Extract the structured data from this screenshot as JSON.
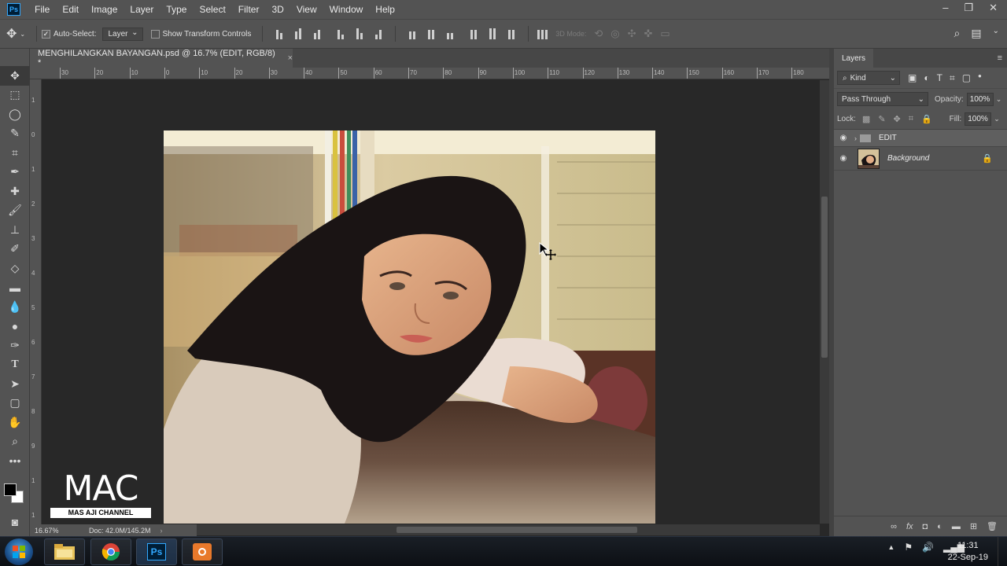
{
  "app": {
    "logo": "Ps"
  },
  "menu": [
    "File",
    "Edit",
    "Image",
    "Layer",
    "Type",
    "Select",
    "Filter",
    "3D",
    "View",
    "Window",
    "Help"
  ],
  "window_controls": [
    "minimize-icon",
    "restore-icon",
    "close-icon"
  ],
  "options_bar": {
    "auto_select_label": "Auto-Select:",
    "auto_select_checked": true,
    "auto_select_target": "Layer",
    "transform_label": "Show Transform Controls",
    "transform_checked": false,
    "mode_3d_label": "3D Mode:"
  },
  "document": {
    "tab_title": "MENGHILANGKAN BAYANGAN.psd @ 16.7% (EDIT, RGB/8) *",
    "close": "×"
  },
  "ruler": {
    "top_labels": [
      "30",
      "20",
      "10",
      "0",
      "10",
      "20",
      "30",
      "40",
      "50",
      "60",
      "70",
      "80",
      "90",
      "100",
      "110",
      "120",
      "130",
      "140",
      "150",
      "160",
      "170",
      "180"
    ],
    "left_labels": [
      "1",
      "0",
      "1",
      "2",
      "3",
      "4",
      "5",
      "6",
      "7",
      "8",
      "9",
      "1",
      "1"
    ]
  },
  "tools": [
    "move-tool-icon",
    "marquee-tool-icon",
    "lasso-tool-icon",
    "quick-select-tool-icon",
    "crop-tool-icon",
    "eyedropper-tool-icon",
    "healing-brush-tool-icon",
    "brush-tool-icon",
    "clone-stamp-tool-icon",
    "history-brush-tool-icon",
    "eraser-tool-icon",
    "gradient-tool-icon",
    "blur-tool-icon",
    "dodge-tool-icon",
    "pen-tool-icon",
    "type-tool-icon",
    "path-select-tool-icon",
    "rectangle-tool-icon",
    "hand-tool-icon",
    "zoom-tool-icon",
    "more-tools-icon"
  ],
  "status": {
    "zoom": "16.67%",
    "doc": "Doc: 42.0M/145.2M"
  },
  "watermark": {
    "logo": "MAC",
    "tagline": "MAS AJI CHANNEL"
  },
  "layers_panel": {
    "tab": "Layers",
    "filter_kind": "Kind",
    "blend_mode": "Pass Through",
    "opacity_label": "Opacity:",
    "opacity": "100%",
    "lock_label": "Lock:",
    "fill_label": "Fill:",
    "fill": "100%",
    "layers": [
      {
        "name": "EDIT",
        "type": "group",
        "visible": true
      },
      {
        "name": "Background",
        "type": "pixel",
        "visible": true,
        "locked": true
      }
    ]
  },
  "taskbar": {
    "apps": [
      "file-explorer-icon",
      "chrome-icon",
      "photoshop-icon",
      "recording-app-icon"
    ],
    "time": "11:31",
    "date": "22-Sep-19"
  },
  "colors": {
    "accent": "#31a8ff",
    "chrome": "#535353",
    "canvas_bg": "#282828"
  }
}
